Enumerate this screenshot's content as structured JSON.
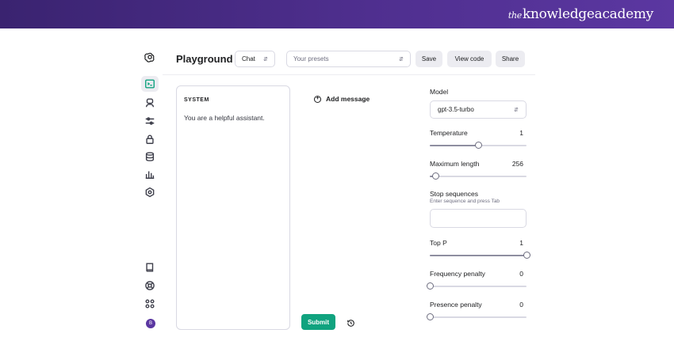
{
  "banner": {
    "brand_prefix": "the",
    "brand_name": "knowledgeacademy"
  },
  "sidebar": {
    "items": [
      {
        "name": "terminal-icon",
        "active": true
      },
      {
        "name": "assistant-icon"
      },
      {
        "name": "tune-icon"
      },
      {
        "name": "lock-icon"
      },
      {
        "name": "database-icon"
      },
      {
        "name": "bar-chart-icon"
      },
      {
        "name": "settings-icon"
      }
    ],
    "bottom_items": [
      "book-icon",
      "help-icon",
      "apps-icon"
    ],
    "avatar_initial": "B"
  },
  "header": {
    "title": "Playground",
    "mode_select": "Chat",
    "presets_placeholder": "Your presets",
    "save_label": "Save",
    "view_code_label": "View code",
    "share_label": "Share"
  },
  "system": {
    "label": "SYSTEM",
    "text": "You are a helpful assistant."
  },
  "chat": {
    "add_message_label": "Add message",
    "submit_label": "Submit"
  },
  "settings": {
    "model_label": "Model",
    "model_value": "gpt-3.5-turbo",
    "temperature": {
      "label": "Temperature",
      "value": "1",
      "fraction": 0.5
    },
    "max_length": {
      "label": "Maximum length",
      "value": "256",
      "fraction": 0.06
    },
    "stop_sequences": {
      "label": "Stop sequences",
      "hint": "Enter sequence and press Tab"
    },
    "top_p": {
      "label": "Top P",
      "value": "1",
      "fraction": 1.0
    },
    "frequency_penalty": {
      "label": "Frequency penalty",
      "value": "0",
      "fraction": 0.0
    },
    "presence_penalty": {
      "label": "Presence penalty",
      "value": "0",
      "fraction": 0.0
    }
  },
  "colors": {
    "accent": "#10a37f",
    "banner": "#4f2f8f"
  }
}
